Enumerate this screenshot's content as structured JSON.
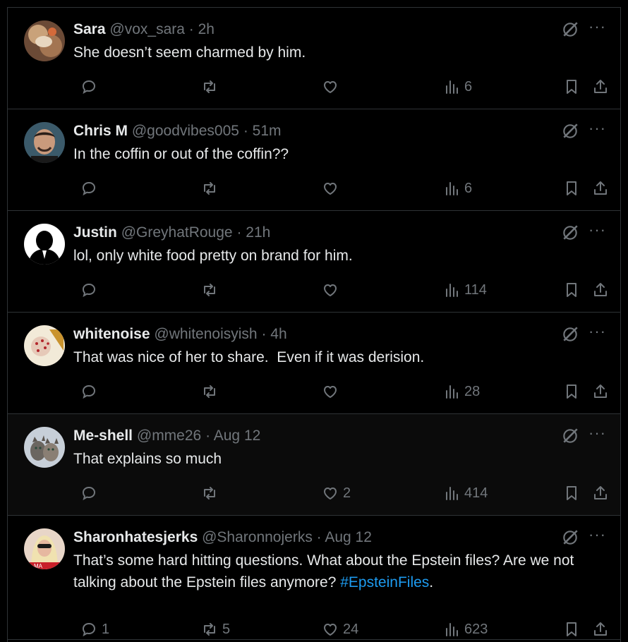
{
  "posts": [
    {
      "name": "Sara",
      "handle": "@vox_sara",
      "time": "2h",
      "text": "She doesn’t seem charmed by him.",
      "reply_count": "",
      "retweet_count": "",
      "like_count": "",
      "views": "6"
    },
    {
      "name": "Chris M",
      "handle": "@goodvibes005",
      "time": "51m",
      "text": "In the coffin or out of the coffin??",
      "reply_count": "",
      "retweet_count": "",
      "like_count": "",
      "views": "6"
    },
    {
      "name": "Justin",
      "handle": "@GreyhatRouge",
      "time": "21h",
      "text": "lol, only white food pretty on brand for him.",
      "reply_count": "",
      "retweet_count": "",
      "like_count": "",
      "views": "114"
    },
    {
      "name": "whitenoise",
      "handle": "@whitenoisyish",
      "time": "4h",
      "text": "That was nice of her to share.  Even if it was derision.",
      "reply_count": "",
      "retweet_count": "",
      "like_count": "",
      "views": "28"
    },
    {
      "name": "Me-shell",
      "handle": "@mme26",
      "time": "Aug 12",
      "text": "That explains so much",
      "reply_count": "",
      "retweet_count": "",
      "like_count": "2",
      "views": "414"
    },
    {
      "name": "Sharonhatesjerks",
      "handle": "@Sharonnojerks",
      "time": "Aug 12",
      "text": "That’s some hard hitting questions. What about the Epstein files? Are we not talking about the Epstein files anymore? ",
      "hashtag": "#EpsteinFiles",
      "text_end": ".",
      "reply_count": "1",
      "retweet_count": "5",
      "like_count": "24",
      "views": "623"
    }
  ],
  "separator": "·",
  "more_glyph": "···",
  "colors": {
    "background": "#000000",
    "text": "#e7e9ea",
    "muted": "#71767b",
    "link": "#1d9bf0",
    "divider": "#2f3336"
  },
  "icons": [
    "reply-icon",
    "retweet-icon",
    "like-icon",
    "views-icon",
    "bookmark-icon",
    "share-icon",
    "grok-icon",
    "more-icon"
  ]
}
